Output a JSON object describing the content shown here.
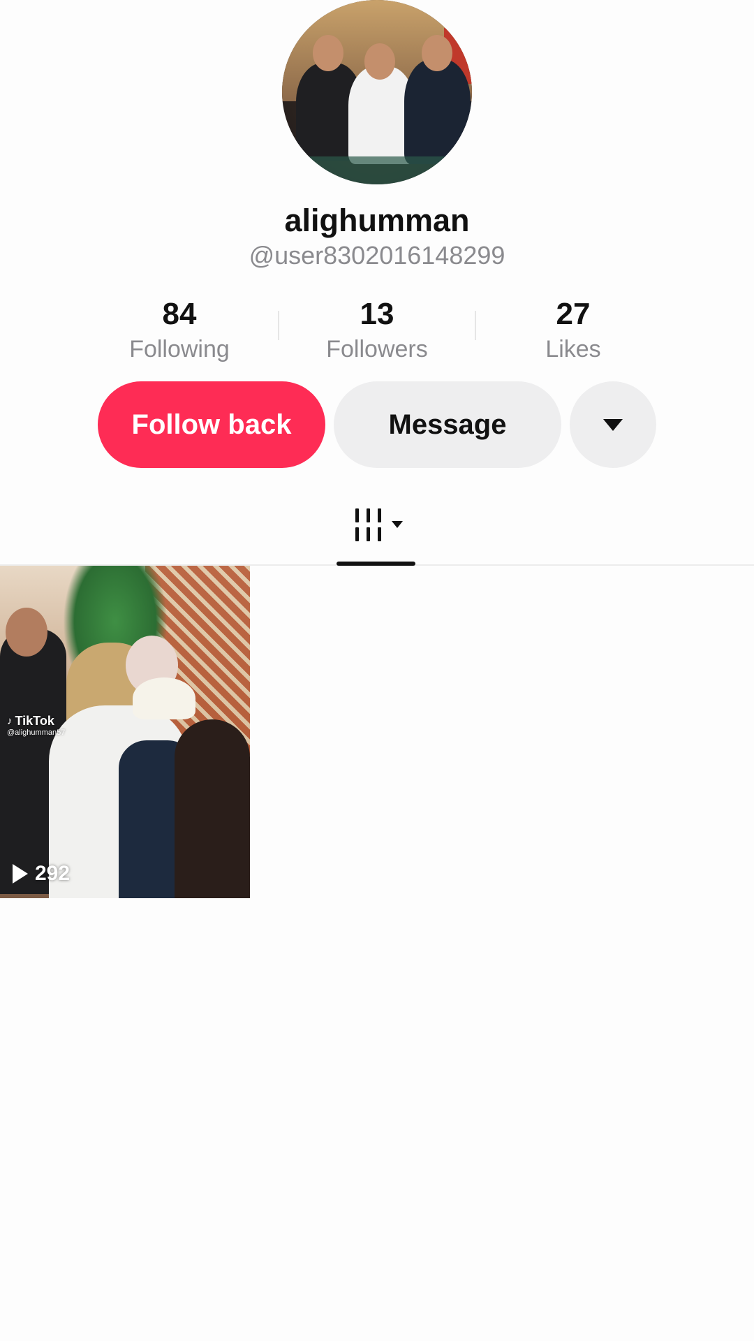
{
  "profile": {
    "display_name": "alighumman",
    "handle": "@user8302016148299",
    "avatar_icon": "profile-photo-group"
  },
  "stats": [
    {
      "value": "84",
      "label": "Following"
    },
    {
      "value": "13",
      "label": "Followers"
    },
    {
      "value": "27",
      "label": "Likes"
    }
  ],
  "actions": {
    "follow_label": "Follow back",
    "message_label": "Message",
    "more_icon": "triangle-down",
    "accent_color": "#fe2c55"
  },
  "tabs": {
    "videos_icon": "grid-videos-icon"
  },
  "videos": [
    {
      "watermark_brand": "TikTok",
      "watermark_user": "@alighumman57",
      "views": "292"
    }
  ]
}
